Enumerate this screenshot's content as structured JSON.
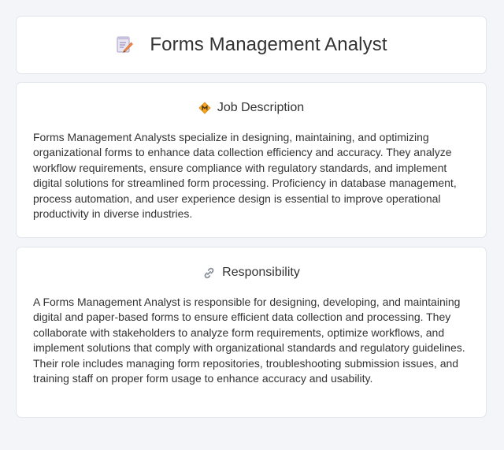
{
  "header": {
    "title": "Forms Management Analyst",
    "icon": "memo-pencil-icon"
  },
  "sections": [
    {
      "title": "Job Description",
      "icon": "diamond-badge-icon",
      "body": "Forms Management Analysts specialize in designing, maintaining, and optimizing organizational forms to enhance data collection efficiency and accuracy. They analyze workflow requirements, ensure compliance with regulatory standards, and implement digital solutions for streamlined form processing. Proficiency in database management, process automation, and user experience design is essential to improve operational productivity in diverse industries."
    },
    {
      "title": "Responsibility",
      "icon": "link-icon",
      "body": "A Forms Management Analyst is responsible for designing, developing, and maintaining digital and paper-based forms to ensure efficient data collection and processing. They collaborate with stakeholders to analyze form requirements, optimize workflows, and implement solutions that comply with organizational standards and regulatory guidelines. Their role includes managing form repositories, troubleshooting submission issues, and training staff on proper form usage to enhance accuracy and usability."
    }
  ],
  "colors": {
    "background": "#f3f5f9",
    "card": "#ffffff",
    "border": "#e1e5ec",
    "text": "#333333",
    "accent_orange": "#f5a623"
  }
}
